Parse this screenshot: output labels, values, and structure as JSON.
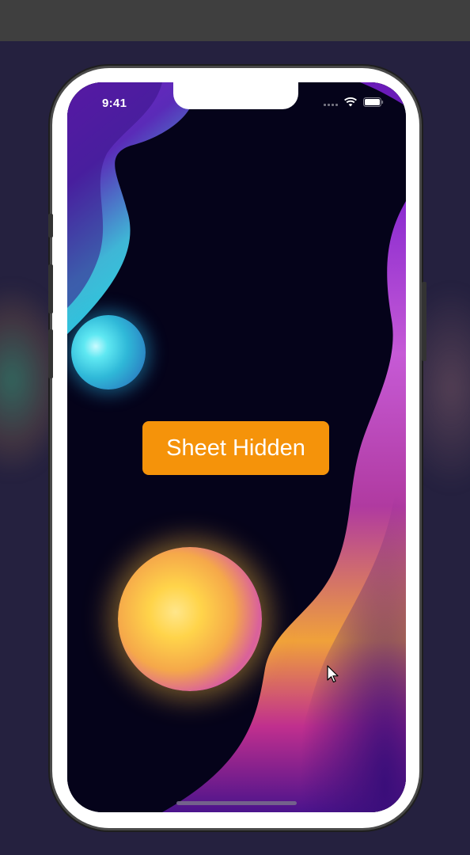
{
  "status_bar": {
    "time": "9:41",
    "icons": [
      "cellular-signal-icon",
      "wifi-icon",
      "battery-icon"
    ]
  },
  "main": {
    "button_label": "Sheet Hidden"
  },
  "colors": {
    "page_background": "#25213f",
    "top_strip": "#3f3f3f",
    "button_background": "#f5930a",
    "button_text": "#ffffff",
    "screen_background": "#05031a"
  },
  "decorations": {
    "orbs": [
      "cyan-orb",
      "gold-orb"
    ],
    "waves": [
      "left-purple-cyan-wave",
      "right-purple-gold-wave"
    ]
  }
}
